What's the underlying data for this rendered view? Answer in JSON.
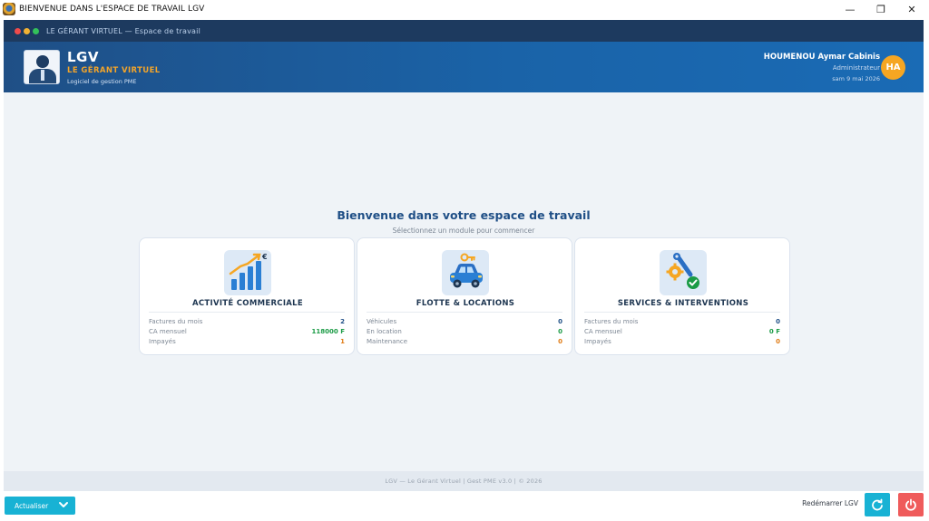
{
  "window": {
    "title": "BIENVENUE DANS L'ESPACE DE TRAVAIL LGV",
    "min_glyph": "—",
    "max_glyph": "❐",
    "close_glyph": "✕"
  },
  "strip": {
    "title": "LE GÉRANT VIRTUEL — Espace de travail"
  },
  "header": {
    "brand_main": "LGV",
    "brand_sub": "LE GÉRANT VIRTUEL",
    "brand_tagline": "Logiciel de gestion PME",
    "user_name": "HOUMENOU Aymar Cabinis",
    "user_role": "Administrateur",
    "date": "sam 9 mai 2026",
    "avatar_initials": "HA",
    "avatar_color": "#f5a623"
  },
  "main": {
    "welcome_title": "Bienvenue dans votre espace de travail",
    "welcome_subtitle": "Sélectionnez un module pour commencer"
  },
  "cards": [
    {
      "icon": "bar-chart-growth-icon",
      "title": "ACTIVITÉ COMMERCIALE",
      "rows": [
        {
          "label": "Factures du mois",
          "value": "2"
        },
        {
          "label": "CA mensuel",
          "value": "118000 F"
        },
        {
          "label": "Impayés",
          "value": "1"
        }
      ]
    },
    {
      "icon": "car-key-icon",
      "title": "FLOTTE & LOCATIONS",
      "rows": [
        {
          "label": "Véhicules",
          "value": "0"
        },
        {
          "label": "En location",
          "value": "0"
        },
        {
          "label": "Maintenance",
          "value": "0"
        }
      ]
    },
    {
      "icon": "wrench-gear-check-icon",
      "title": "SERVICES & INTERVENTIONS",
      "rows": [
        {
          "label": "Factures du mois",
          "value": "0"
        },
        {
          "label": "CA mensuel",
          "value": "0 F"
        },
        {
          "label": "Impayés",
          "value": "0"
        }
      ]
    }
  ],
  "footer": {
    "text": "LGV — Le Gérant Virtuel  |  Gest PME v3.0  |  © 2026"
  },
  "bottom": {
    "refresh_label": "Actualiser",
    "restart_label": "Redémarrer LGV"
  },
  "colors": {
    "accent": "#18b2d4",
    "brand": "#1f4f86",
    "danger": "#ef5b5b",
    "orange": "#f2a42a",
    "green": "#1a9b45"
  }
}
